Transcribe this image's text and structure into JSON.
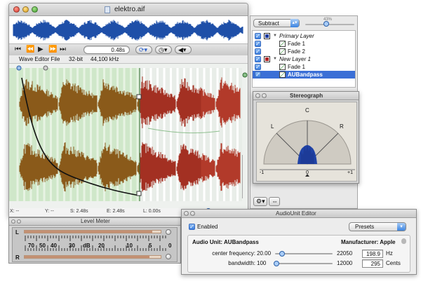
{
  "wave_window": {
    "title": "elektro.aif",
    "time_field": "0.48s",
    "info_label": "Wave Editor File",
    "info_bits": "32-bit",
    "info_rate": "44,100 kHz",
    "status": {
      "x": "X: --",
      "y": "Y: --",
      "s": "S: 2.48s",
      "e": "E: 2.48s",
      "l": "L: 0.00s"
    }
  },
  "layers_panel": {
    "mode": "Subtract",
    "opacity": "43%",
    "layers": [
      {
        "name": "Primary Layer",
        "kind": "group",
        "color": "#1f3da0",
        "checked": true
      },
      {
        "name": "Fade 1",
        "kind": "effect",
        "checked": true
      },
      {
        "name": "Fade 2",
        "kind": "effect",
        "checked": true
      },
      {
        "name": "New Layer 1",
        "kind": "group",
        "color": "#b22424",
        "checked": true
      },
      {
        "name": "Fade 1",
        "kind": "effect",
        "checked": true
      },
      {
        "name": "AUBandpass",
        "kind": "effect",
        "checked": true,
        "selected": true
      }
    ]
  },
  "stereograph": {
    "title": "Stereograph",
    "labels": {
      "c": "C",
      "l": "L",
      "r": "R",
      "min": "-1",
      "zero": "0",
      "max": "+1"
    }
  },
  "level_meter": {
    "title": "Level Meter",
    "ch_left": "L",
    "ch_right": "R",
    "scale": [
      "70",
      "50",
      "40",
      "30",
      "dB",
      "20",
      "10",
      "5",
      "0"
    ],
    "l_level": 0.94,
    "r_level": 0.92
  },
  "au_editor": {
    "title": "AudioUnit Editor",
    "enabled_label": "Enabled",
    "presets_label": "Presets",
    "au_name_label": "Audio Unit: AUBandpass",
    "manufacturer_label": "Manufacturer: Apple",
    "params": [
      {
        "label": "center frequency:",
        "min": "20.00",
        "max": "22050",
        "value": "198.9",
        "unit": "Hz",
        "pos": 0.12
      },
      {
        "label": "bandwidth:",
        "min": "100",
        "max": "12000",
        "value": "295",
        "unit": "Cents",
        "pos": 0.03
      }
    ]
  },
  "colors": {
    "accent": "#3b7fde",
    "wave_blue": "#1e4fa8",
    "wave_brown": "#8a5a1a",
    "wave_red": "#a33022",
    "bg_green": "#cfe7c9"
  }
}
